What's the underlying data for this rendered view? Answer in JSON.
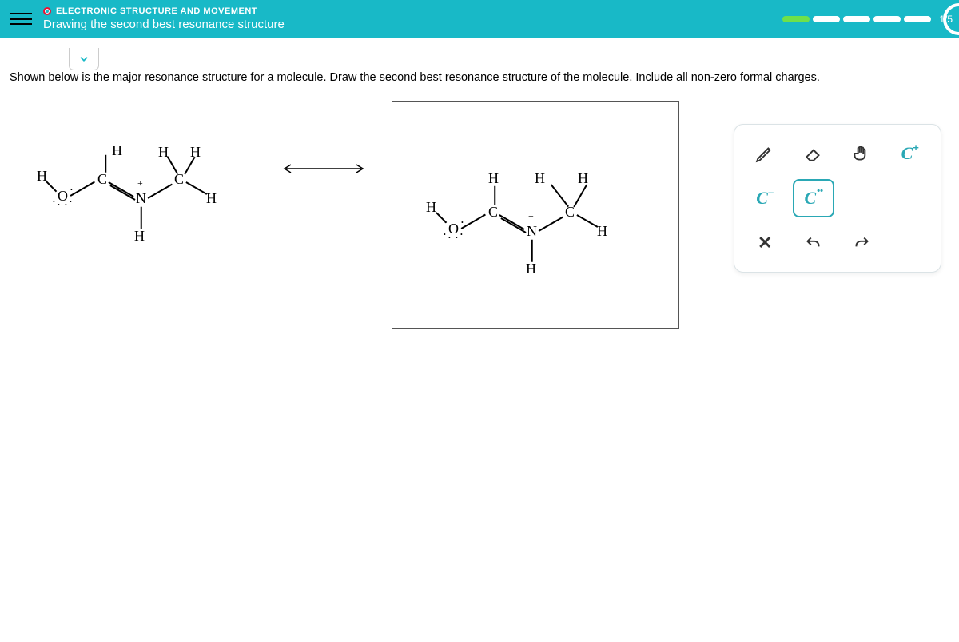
{
  "header": {
    "chapter": "ELECTRONIC STRUCTURE AND MOVEMENT",
    "lesson": "Drawing the second best resonance structure",
    "progress_counter": "1/5"
  },
  "prompt": "Shown below is the major resonance structure for a molecule. Draw the second best resonance structure of the molecule. Include all non-zero formal charges.",
  "tools": {
    "pencil": "pencil",
    "eraser": "eraser",
    "hand": "hand",
    "c_plus": "C",
    "c_minus": "C",
    "c_dots": "C",
    "close": "×",
    "undo": "undo",
    "redo": "redo"
  },
  "molecule_left": {
    "atoms": [
      "O",
      "C",
      "N",
      "C",
      "H",
      "H",
      "H",
      "H",
      "H",
      "H"
    ],
    "charge_on": "N",
    "charge": "+"
  },
  "molecule_right": {
    "atoms": [
      "O",
      "C",
      "N",
      "C",
      "H",
      "H",
      "H",
      "H",
      "H",
      "H"
    ],
    "charge_on": "N",
    "charge": "+"
  }
}
